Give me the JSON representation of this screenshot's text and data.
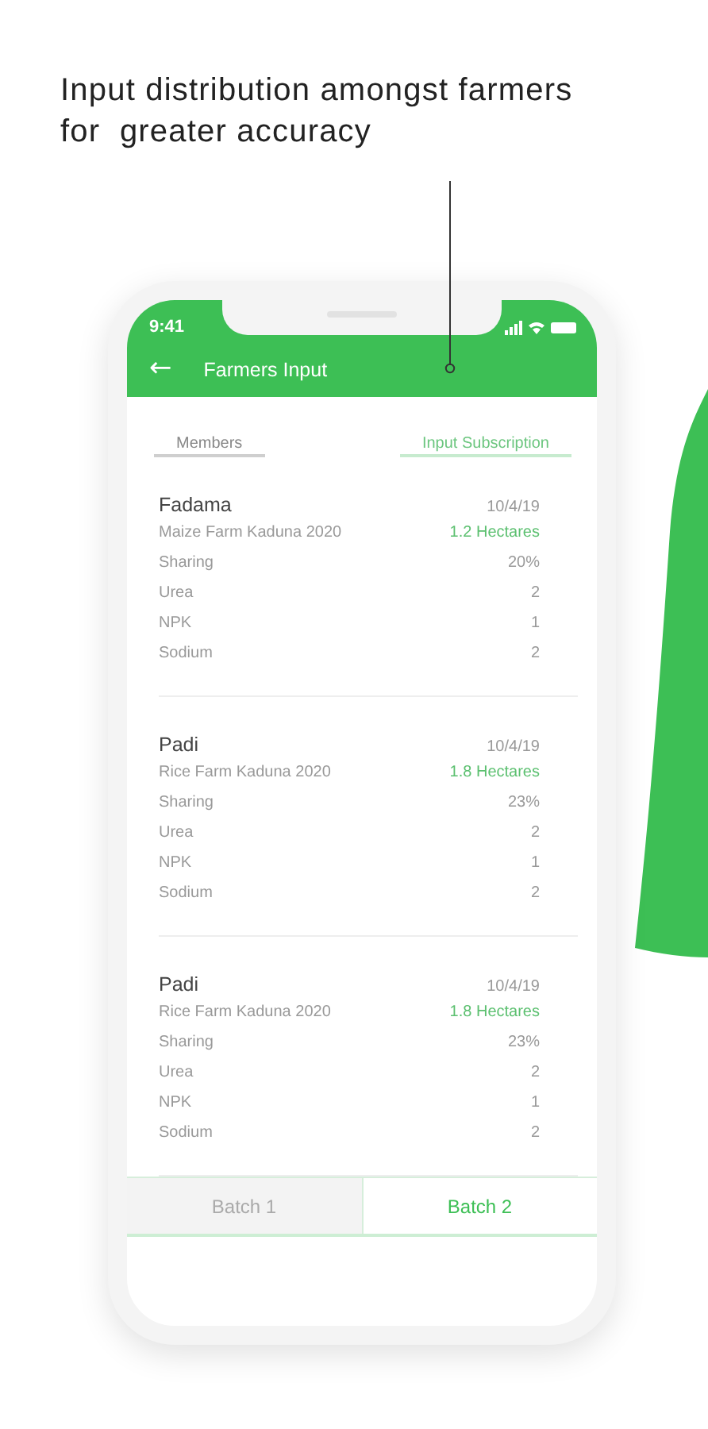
{
  "caption": [
    "Input distribution amongst farmers",
    "for  greater accuracy"
  ],
  "status_bar": {
    "time": "9:41"
  },
  "header": {
    "back": "←",
    "title": "Farmers Input"
  },
  "tabs": [
    {
      "label": "Members",
      "selected": false
    },
    {
      "label": "Input Subscription",
      "selected": true
    }
  ],
  "records": [
    {
      "name": "Fadama",
      "date": "10/4/19",
      "farm": "Maize Farm Kaduna 2020",
      "area": "1.2 Hectares",
      "rows": [
        {
          "label": "Sharing",
          "value": "20%"
        },
        {
          "label": "Urea",
          "value": "2"
        },
        {
          "label": "NPK",
          "value": "1"
        },
        {
          "label": "Sodium",
          "value": "2"
        }
      ]
    },
    {
      "name": "Padi",
      "date": "10/4/19",
      "farm": "Rice Farm Kaduna 2020",
      "area": "1.8 Hectares",
      "rows": [
        {
          "label": "Sharing",
          "value": "23%"
        },
        {
          "label": "Urea",
          "value": "2"
        },
        {
          "label": "NPK",
          "value": "1"
        },
        {
          "label": "Sodium",
          "value": "2"
        }
      ]
    },
    {
      "name": "Padi",
      "date": "10/4/19",
      "farm": "Rice Farm Kaduna 2020",
      "area": "1.8 Hectares",
      "rows": [
        {
          "label": "Sharing",
          "value": "23%"
        },
        {
          "label": "Urea",
          "value": "2"
        },
        {
          "label": "NPK",
          "value": "1"
        },
        {
          "label": "Sodium",
          "value": "2"
        }
      ]
    }
  ],
  "batches": [
    {
      "label": "Batch 1",
      "selected": false
    },
    {
      "label": "Batch 2",
      "selected": true
    }
  ]
}
